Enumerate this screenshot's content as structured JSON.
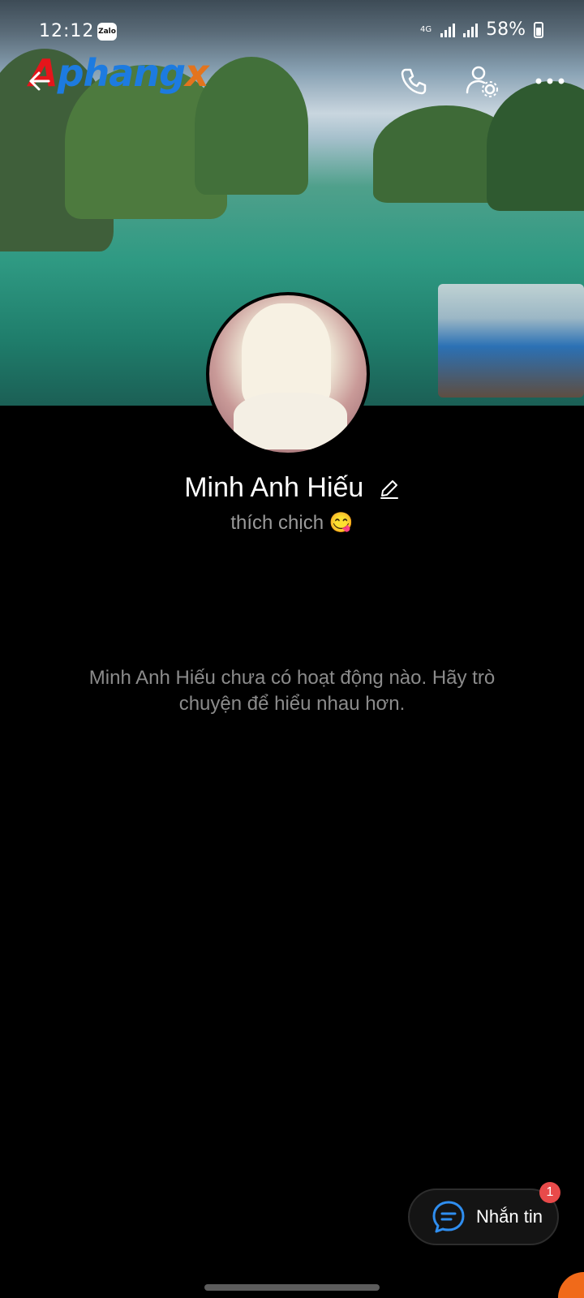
{
  "status_bar": {
    "time": "12:12",
    "app_badge": "Zalo",
    "network": "4G",
    "battery": "58%"
  },
  "header": {
    "logo_text": "Aphangx"
  },
  "profile": {
    "name": "Minh Anh Hiếu",
    "status": "thích chịch 😋"
  },
  "empty_state": {
    "message": "Minh Anh Hiếu chưa có hoạt động nào. Hãy trò chuyện để hiểu nhau hơn."
  },
  "actions": {
    "message_label": "Nhắn tin",
    "message_badge": "1"
  },
  "colors": {
    "background": "#000000",
    "accent": "#1d7be0",
    "badge": "#e84a4a"
  },
  "icons": [
    "back-arrow-icon",
    "phone-icon",
    "user-settings-icon",
    "more-icon",
    "edit-icon",
    "chat-icon"
  ]
}
